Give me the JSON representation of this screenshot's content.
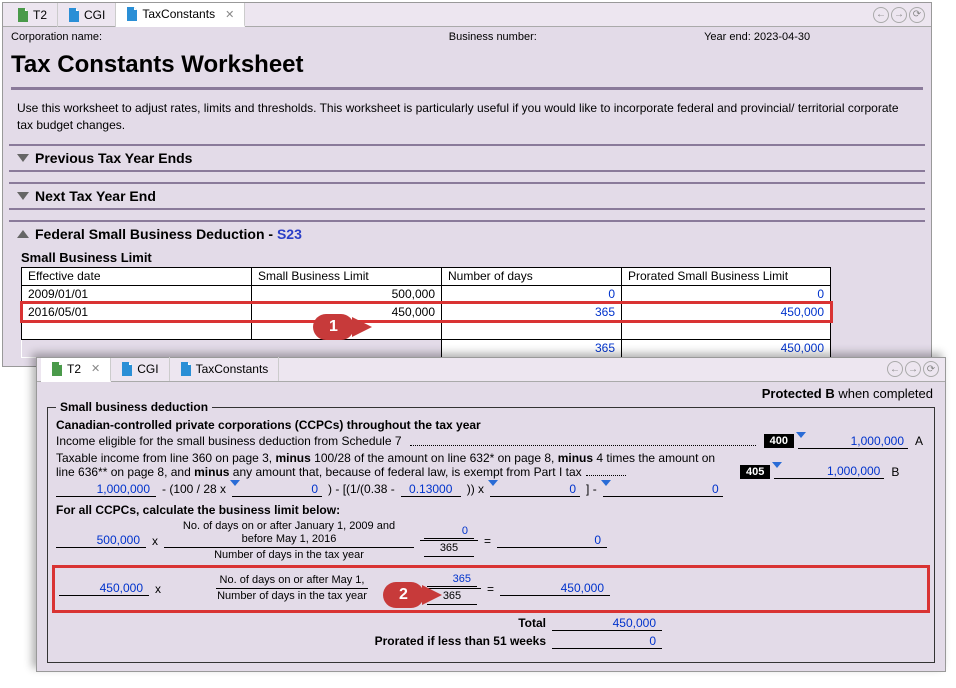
{
  "win1": {
    "tabs": [
      {
        "label": "T2",
        "icon": "green"
      },
      {
        "label": "CGI",
        "icon": "blue"
      },
      {
        "label": "TaxConstants",
        "icon": "blue",
        "active": true,
        "close": true
      }
    ],
    "info": {
      "corp_label": "Corporation name:",
      "bus_label": "Business number:",
      "year_label": "Year end:",
      "year_val": "2023-04-30"
    },
    "title": "Tax Constants Worksheet",
    "desc": "Use this worksheet to adjust rates, limits and thresholds. This worksheet is particularly useful if you would like to incorporate federal and provincial/ territorial corporate tax budget changes.",
    "sections": {
      "prev": "Previous Tax Year Ends",
      "next": "Next Tax Year End",
      "fed": "Federal Small Business Deduction - ",
      "fed_link": "S23"
    },
    "table": {
      "title": "Small Business Limit",
      "headers": [
        "Effective date",
        "Small Business Limit",
        "Number of days",
        "Prorated Small Business Limit"
      ],
      "rows": [
        {
          "date": "2009/01/01",
          "limit": "500,000",
          "days": "0",
          "prorated": "0"
        },
        {
          "date": "2016/05/01",
          "limit": "450,000",
          "days": "365",
          "prorated": "450,000",
          "hl": true
        }
      ],
      "footer": {
        "days": "365",
        "prorated": "450,000"
      }
    }
  },
  "callouts": {
    "c1": "1",
    "c2": "2"
  },
  "win2": {
    "tabs": [
      {
        "label": "T2",
        "icon": "green",
        "active": true,
        "close": true
      },
      {
        "label": "CGI",
        "icon": "blue"
      },
      {
        "label": "TaxConstants",
        "icon": "blue"
      }
    ],
    "protected_a": "Protected B",
    "protected_b": " when completed",
    "legend": "Small business deduction",
    "ccpc_hdr": "Canadian-controlled private corporations (CCPCs) throughout the tax year",
    "line400": {
      "text": "Income eligible for the small business deduction from Schedule 7",
      "box": "400",
      "val": "1,000,000",
      "letter": "A"
    },
    "line405": {
      "text_a": "Taxable income from line 360 on page 3, ",
      "minus1": "minus",
      "text_b": " 100/28 of the amount on line 632* on page 8, ",
      "minus2": "minus",
      "text_c": " 4 times the amount on line 636** on page 8, and ",
      "minus3": "minus",
      "text_d": " any amount that, because of federal law, is exempt from Part I tax",
      "box": "405",
      "val": "1,000,000",
      "letter": "B"
    },
    "calc1": {
      "v1": "1,000,000",
      "t1": "- (100 / 28 x",
      "v2": "0",
      "t2": ") - [(1/(0.38 -",
      "v3": "0.13000",
      "t3": ")) x",
      "v4": "0",
      "t4": "] -",
      "v5": "0"
    },
    "ccpc_all": "For all CCPCs, calculate the business limit below:",
    "row1": {
      "base": "500,000",
      "mult": "x",
      "frac_top": "No. of days on or after January 1, 2009 and before May 1, 2016",
      "frac_bot": "Number of days in the tax year",
      "num": "0",
      "den": "365",
      "eq": "=",
      "res": "0"
    },
    "row2": {
      "base": "450,000",
      "mult": "x",
      "frac_top": "No. of days on or after May 1,",
      "frac_bot": "Number of days in the tax year",
      "num": "365",
      "den": "365",
      "eq": "=",
      "res": "450,000"
    },
    "total": {
      "label": "Total",
      "val": "450,000"
    },
    "prorated": {
      "label": "Prorated if less than 51 weeks",
      "val": "0"
    }
  }
}
